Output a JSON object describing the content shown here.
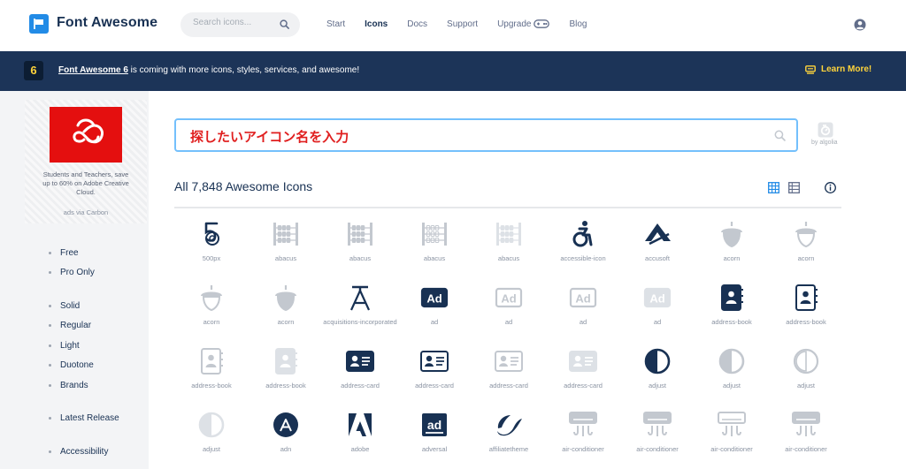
{
  "nav": {
    "brand": "Font Awesome",
    "search_placeholder": "Search icons...",
    "items": [
      {
        "label": "Start",
        "active": false
      },
      {
        "label": "Icons",
        "active": true
      },
      {
        "label": "Docs",
        "active": false
      },
      {
        "label": "Support",
        "active": false
      },
      {
        "label": "Upgrade",
        "active": false
      },
      {
        "label": "Blog",
        "active": false
      }
    ]
  },
  "banner": {
    "badge": "6",
    "link_text": "Font Awesome 6",
    "text": " is coming with more icons, styles, services, and awesome!",
    "cta": "Learn More!"
  },
  "sidebar": {
    "ad_text": "Students and Teachers, save up to 60% on Adobe Creative Cloud.",
    "ad_via": "ads via Carbon",
    "filters": [
      "Free",
      "Pro Only",
      "Solid",
      "Regular",
      "Light",
      "Duotone",
      "Brands",
      "Latest Release",
      "Accessibility"
    ]
  },
  "search": {
    "query": "探したいアイコン名を入力",
    "powered_by": "by algolia"
  },
  "results": {
    "heading": "All 7,848 Awesome Icons"
  },
  "colors": {
    "dark": "#183153",
    "muted": "#c3c8cf",
    "banner": "#1c3458",
    "accent": "#ffd43b",
    "logo": "#228be6",
    "focus": "#74c0fc"
  },
  "icons": [
    {
      "label": "500px",
      "icon": "500px-icon",
      "shade": "dark"
    },
    {
      "label": "abacus",
      "icon": "abacus-icon",
      "shade": "muted"
    },
    {
      "label": "abacus",
      "icon": "abacus-icon",
      "shade": "muted"
    },
    {
      "label": "abacus",
      "icon": "abacus-outline-icon",
      "shade": "muted"
    },
    {
      "label": "abacus",
      "icon": "abacus-icon",
      "shade": "light"
    },
    {
      "label": "accessible-icon",
      "icon": "accessible-icon",
      "shade": "dark"
    },
    {
      "label": "accusoft",
      "icon": "accusoft-icon",
      "shade": "dark"
    },
    {
      "label": "acorn",
      "icon": "acorn-icon",
      "shade": "muted"
    },
    {
      "label": "acorn",
      "icon": "acorn-outline-icon",
      "shade": "muted"
    },
    {
      "label": "acorn",
      "icon": "acorn-outline-icon",
      "shade": "muted"
    },
    {
      "label": "acorn",
      "icon": "acorn-icon",
      "shade": "muted"
    },
    {
      "label": "acquisitions-incorporated",
      "icon": "acquisitions-incorporated-icon",
      "shade": "dark"
    },
    {
      "label": "ad",
      "icon": "ad-icon",
      "shade": "dark"
    },
    {
      "label": "ad",
      "icon": "ad-outline-icon",
      "shade": "muted"
    },
    {
      "label": "ad",
      "icon": "ad-outline-icon",
      "shade": "muted"
    },
    {
      "label": "ad",
      "icon": "ad-icon",
      "shade": "light"
    },
    {
      "label": "address-book",
      "icon": "address-book-icon",
      "shade": "dark"
    },
    {
      "label": "address-book",
      "icon": "address-book-outline-icon",
      "shade": "dark"
    },
    {
      "label": "address-book",
      "icon": "address-book-outline-icon",
      "shade": "muted"
    },
    {
      "label": "address-book",
      "icon": "address-book-icon",
      "shade": "light"
    },
    {
      "label": "address-card",
      "icon": "address-card-icon",
      "shade": "dark"
    },
    {
      "label": "address-card",
      "icon": "address-card-outline-icon",
      "shade": "dark"
    },
    {
      "label": "address-card",
      "icon": "address-card-outline-icon",
      "shade": "muted"
    },
    {
      "label": "address-card",
      "icon": "address-card-icon",
      "shade": "light"
    },
    {
      "label": "adjust",
      "icon": "adjust-icon",
      "shade": "dark"
    },
    {
      "label": "adjust",
      "icon": "adjust-icon",
      "shade": "muted"
    },
    {
      "label": "adjust",
      "icon": "adjust-outline-icon",
      "shade": "muted"
    },
    {
      "label": "adjust",
      "icon": "adjust-icon",
      "shade": "light"
    },
    {
      "label": "adn",
      "icon": "adn-icon",
      "shade": "dark"
    },
    {
      "label": "adobe",
      "icon": "adobe-icon",
      "shade": "dark"
    },
    {
      "label": "adversal",
      "icon": "adversal-icon",
      "shade": "dark"
    },
    {
      "label": "affiliatetheme",
      "icon": "affiliatetheme-icon",
      "shade": "dark"
    },
    {
      "label": "air-conditioner",
      "icon": "air-conditioner-icon",
      "shade": "muted"
    },
    {
      "label": "air-conditioner",
      "icon": "air-conditioner-icon",
      "shade": "muted"
    },
    {
      "label": "air-conditioner",
      "icon": "air-conditioner-outline-icon",
      "shade": "muted"
    },
    {
      "label": "air-conditioner",
      "icon": "air-conditioner-icon",
      "shade": "muted"
    }
  ]
}
